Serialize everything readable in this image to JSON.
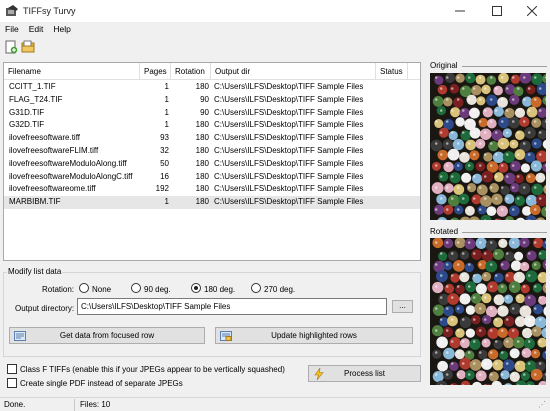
{
  "window": {
    "title": "TIFFsy Turvy"
  },
  "menu": {
    "file": "File",
    "edit": "Edit",
    "help": "Help"
  },
  "toolbar": {
    "new_icon": "new-document-icon",
    "open_icon": "open-folder-icon"
  },
  "list": {
    "columns": [
      "Filename",
      "Pages",
      "Rotation",
      "Output dir",
      "Status"
    ],
    "rows": [
      {
        "name": "CCITT_1.TIF",
        "pages": "1",
        "rotation": "180",
        "dir": "C:\\Users\\ILFS\\Desktop\\TIFF Sample Files",
        "status": ""
      },
      {
        "name": "FLAG_T24.TIF",
        "pages": "1",
        "rotation": "90",
        "dir": "C:\\Users\\ILFS\\Desktop\\TIFF Sample Files",
        "status": ""
      },
      {
        "name": "G31D.TIF",
        "pages": "1",
        "rotation": "90",
        "dir": "C:\\Users\\ILFS\\Desktop\\TIFF Sample Files",
        "status": ""
      },
      {
        "name": "G32D.TIF",
        "pages": "1",
        "rotation": "180",
        "dir": "C:\\Users\\ILFS\\Desktop\\TIFF Sample Files",
        "status": ""
      },
      {
        "name": "ilovefreesoftware.tiff",
        "pages": "93",
        "rotation": "180",
        "dir": "C:\\Users\\ILFS\\Desktop\\TIFF Sample Files",
        "status": ""
      },
      {
        "name": "ilovefreesoftwareFLIM.tiff",
        "pages": "32",
        "rotation": "180",
        "dir": "C:\\Users\\ILFS\\Desktop\\TIFF Sample Files",
        "status": ""
      },
      {
        "name": "ilovefreesoftwareModuloAlong.tiff",
        "pages": "50",
        "rotation": "180",
        "dir": "C:\\Users\\ILFS\\Desktop\\TIFF Sample Files",
        "status": ""
      },
      {
        "name": "ilovefreesoftwareModuloAlongC.tiff",
        "pages": "16",
        "rotation": "180",
        "dir": "C:\\Users\\ILFS\\Desktop\\TIFF Sample Files",
        "status": ""
      },
      {
        "name": "ilovefreesoftwareome.tiff",
        "pages": "192",
        "rotation": "180",
        "dir": "C:\\Users\\ILFS\\Desktop\\TIFF Sample Files",
        "status": ""
      },
      {
        "name": "MARBIBM.TIF",
        "pages": "1",
        "rotation": "180",
        "dir": "C:\\Users\\ILFS\\Desktop\\TIFF Sample Files",
        "status": ""
      }
    ],
    "selected_index": 9
  },
  "modify": {
    "group_label": "Modify list data",
    "rotation_label": "Rotation:",
    "options": [
      "None",
      "90 deg.",
      "180 deg.",
      "270 deg."
    ],
    "selected_option": "180 deg.",
    "outdir_label": "Output directory:",
    "outdir_value": "C:\\Users\\ILFS\\Desktop\\TIFF Sample Files",
    "browse_label": "...",
    "get_data_label": "Get data from focused row",
    "update_label": "Update highlighted rows"
  },
  "options": {
    "classf_label": "Class F TIFFs (enable this if your JPEGs appear to be vertically squashed)",
    "classf_checked": false,
    "pdf_label": "Create single PDF instead of separate JPEGs",
    "pdf_checked": false,
    "process_label": "Process list"
  },
  "preview": {
    "original_label": "Original",
    "rotated_label": "Rotated"
  },
  "status": {
    "text": "Done.",
    "files": "Files: 10"
  },
  "colors": {
    "window_bg": "#f0f0f0",
    "selected_row": "#e6e6e6",
    "button_bg": "#e1e1e1"
  }
}
